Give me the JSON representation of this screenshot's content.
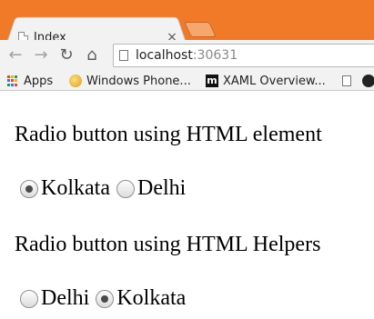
{
  "browser": {
    "tab": {
      "title": "Index",
      "close_glyph": "×"
    },
    "toolbar": {
      "back_glyph": "←",
      "forward_glyph": "→",
      "reload_glyph": "↻",
      "home_glyph": "⌂"
    },
    "omnibox": {
      "host": "localhost",
      "port": ":30631"
    },
    "bookmarks": [
      {
        "label": "Apps",
        "icon": "apps-grid-icon"
      },
      {
        "label": "Windows Phone...",
        "icon": "windows-phone-icon"
      },
      {
        "label": "XAML Overview...",
        "icon": "m-logo-icon"
      },
      {
        "label": "",
        "icon": "document-icon"
      },
      {
        "label": "",
        "icon": "dark-circle-icon"
      }
    ],
    "colors": {
      "title_bar": "#f07a27",
      "toolbar": "#f2f2f2"
    }
  },
  "page": {
    "section1": {
      "heading": "Radio button using HTML element",
      "options": [
        {
          "label": "Kolkata",
          "checked": true
        },
        {
          "label": "Delhi",
          "checked": false
        }
      ]
    },
    "section2": {
      "heading": "Radio button using HTML Helpers",
      "options": [
        {
          "label": "Delhi",
          "checked": false
        },
        {
          "label": "Kolkata",
          "checked": true
        }
      ]
    }
  }
}
